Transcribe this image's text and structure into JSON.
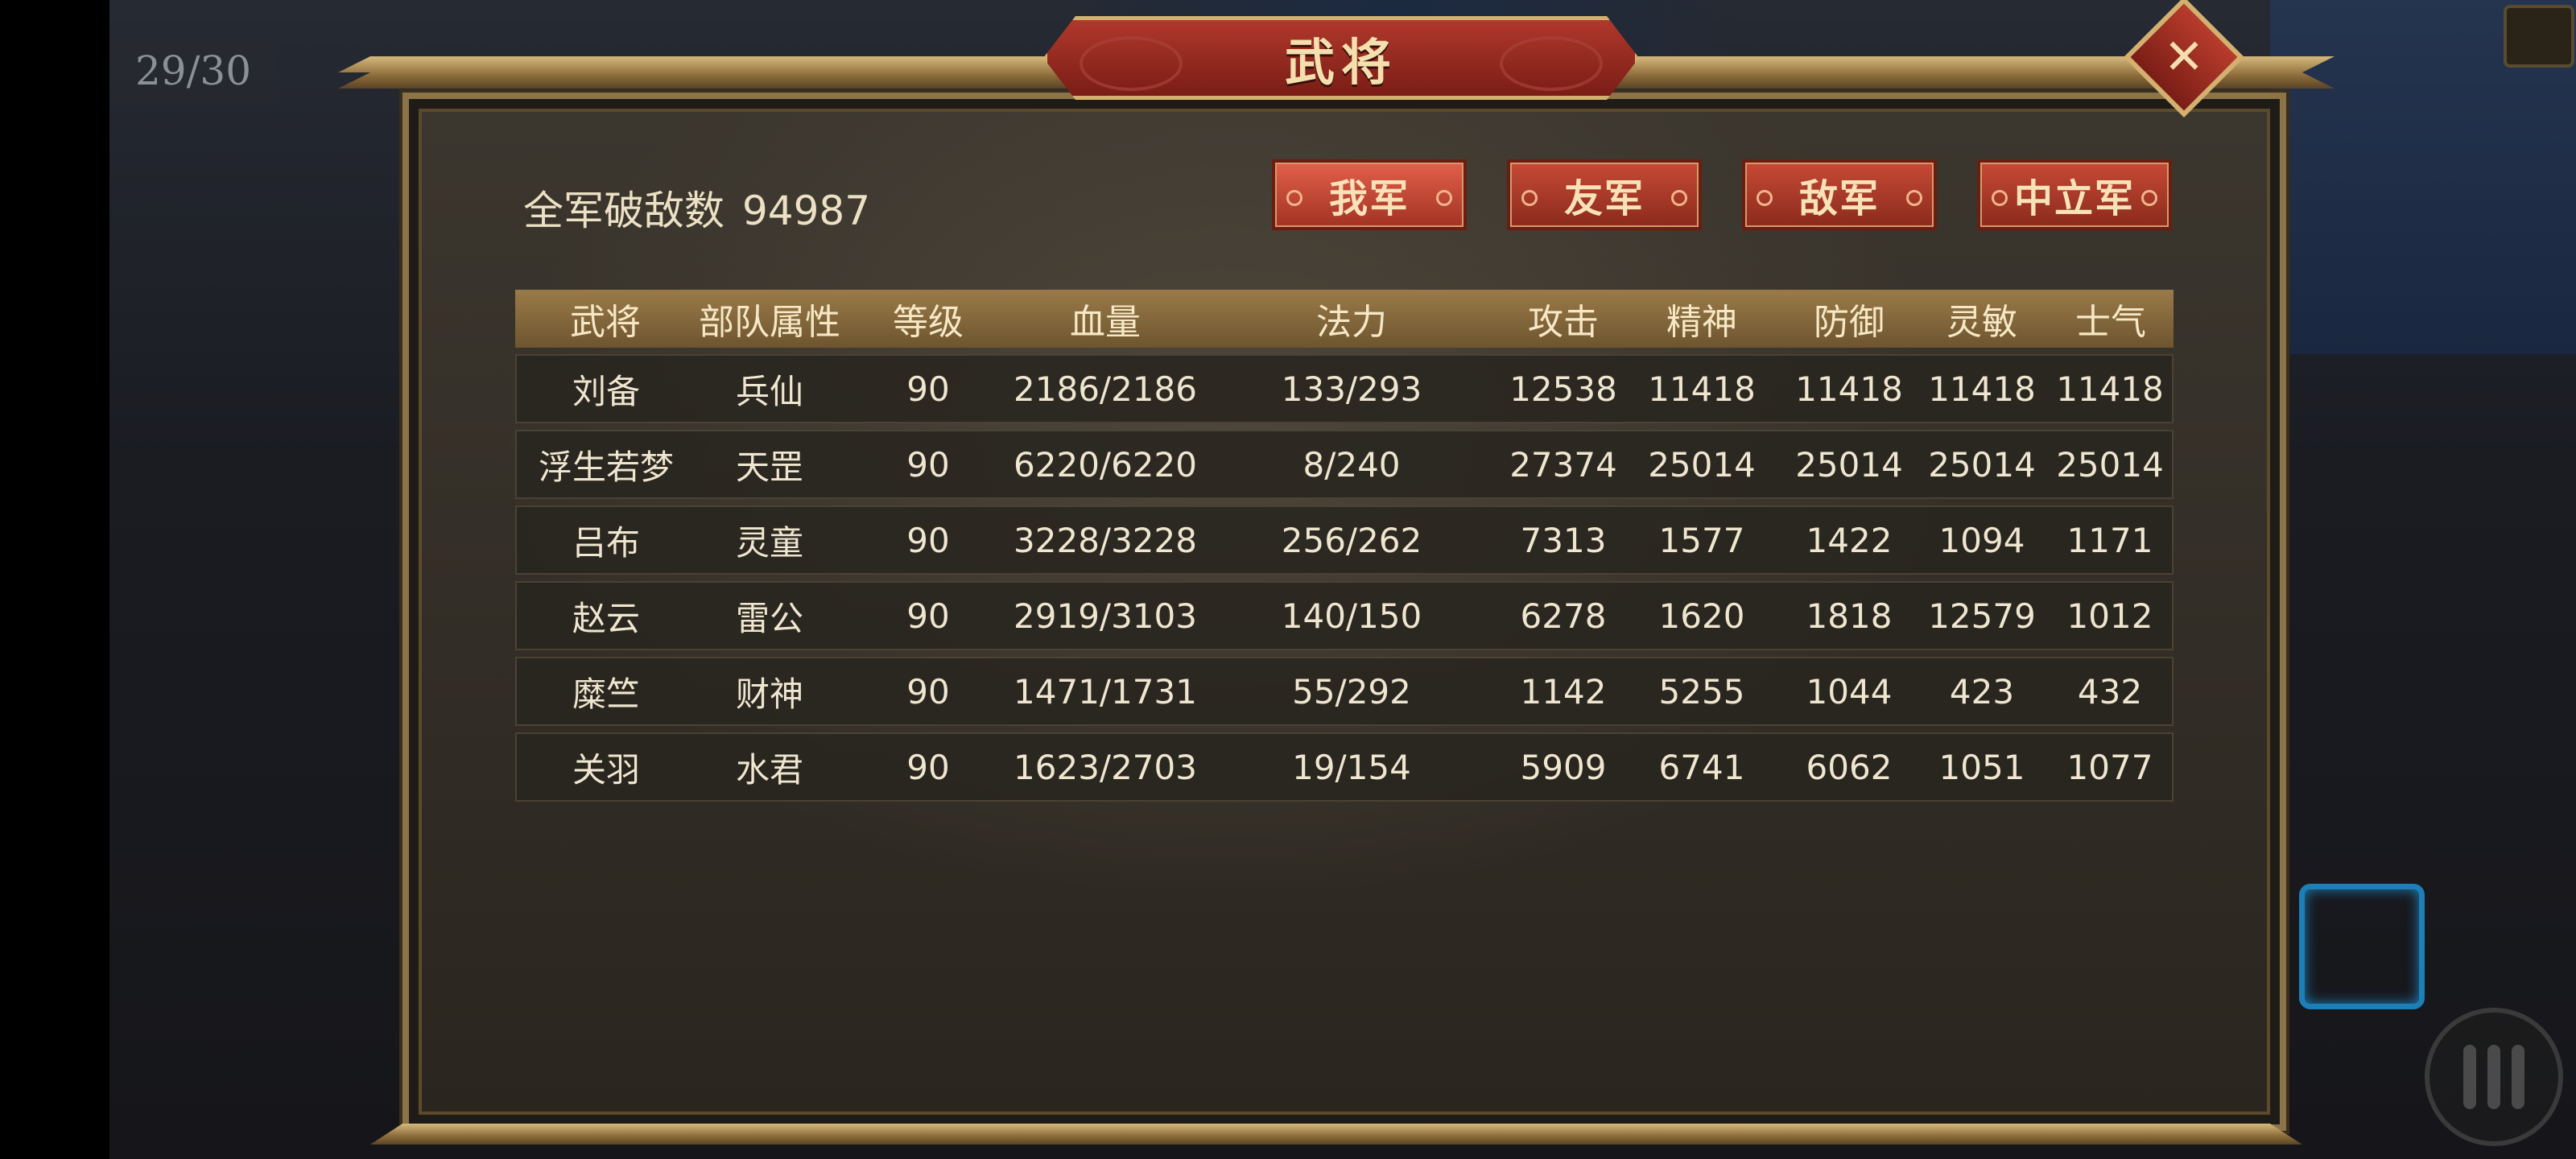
{
  "hud": {
    "page_counter": "29/30"
  },
  "dialog": {
    "title": "武将",
    "close_icon": "✕",
    "kills_label": "全军破敌数",
    "kills_value": "94987",
    "tabs": [
      "我军",
      "友军",
      "敌军",
      "中立军"
    ],
    "active_tab": "我军",
    "columns": [
      "武将",
      "部队属性",
      "等级",
      "血量",
      "法力",
      "攻击",
      "精神",
      "防御",
      "灵敏",
      "士气"
    ],
    "rows": [
      [
        "刘备",
        "兵仙",
        "90",
        "2186/2186",
        "133/293",
        "12538",
        "11418",
        "11418",
        "11418",
        "11418"
      ],
      [
        "浮生若梦",
        "天罡",
        "90",
        "6220/6220",
        "8/240",
        "27374",
        "25014",
        "25014",
        "25014",
        "25014"
      ],
      [
        "吕布",
        "灵童",
        "90",
        "3228/3228",
        "256/262",
        "7313",
        "1577",
        "1422",
        "1094",
        "1171"
      ],
      [
        "赵云",
        "雷公",
        "90",
        "2919/3103",
        "140/150",
        "6278",
        "1620",
        "1818",
        "12579",
        "1012"
      ],
      [
        "糜竺",
        "财神",
        "90",
        "1471/1731",
        "55/292",
        "1142",
        "5255",
        "1044",
        "423",
        "432"
      ],
      [
        "关羽",
        "水君",
        "90",
        "1623/2703",
        "19/154",
        "5909",
        "6741",
        "6062",
        "1051",
        "1077"
      ]
    ]
  },
  "colors": {
    "accent_red": "#b0382c",
    "gold_trim": "#d4b070",
    "panel_bg": "#332e27"
  }
}
